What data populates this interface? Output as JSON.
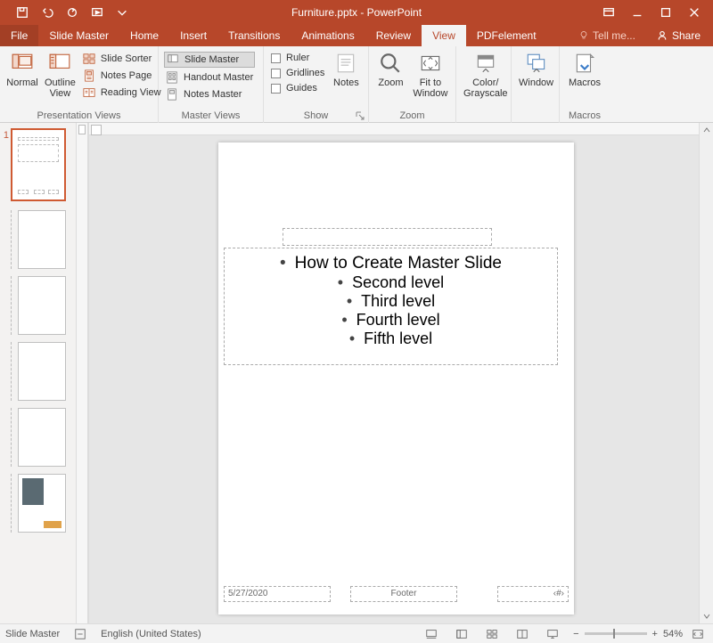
{
  "app": {
    "title": "Furniture.pptx - PowerPoint"
  },
  "tabs": {
    "file": "File",
    "items": [
      "Slide Master",
      "Home",
      "Insert",
      "Transitions",
      "Animations",
      "Review",
      "View",
      "PDFelement"
    ],
    "active": "View",
    "tell": "Tell me...",
    "share": "Share"
  },
  "ribbon": {
    "presentation_views": {
      "label": "Presentation Views",
      "normal": "Normal",
      "outline": "Outline View",
      "slide_sorter": "Slide Sorter",
      "notes_page": "Notes Page",
      "reading_view": "Reading View"
    },
    "master_views": {
      "label": "Master Views",
      "slide_master": "Slide Master",
      "handout_master": "Handout Master",
      "notes_master": "Notes Master"
    },
    "show": {
      "label": "Show",
      "ruler": "Ruler",
      "gridlines": "Gridlines",
      "guides": "Guides",
      "notes": "Notes"
    },
    "zoom_group": {
      "label": "Zoom",
      "zoom": "Zoom",
      "fit": "Fit to Window"
    },
    "color": {
      "label": "Color/ Grayscale"
    },
    "window": {
      "label": "Window"
    },
    "macros": {
      "label": "Macros",
      "button": "Macros"
    }
  },
  "slide": {
    "body": {
      "l1": "How to Create Master Slide",
      "l2": "Second level",
      "l3": "Third level",
      "l4": "Fourth level",
      "l5": "Fifth level"
    },
    "date": "5/27/2020",
    "footer": "Footer",
    "number": "‹#›"
  },
  "thumbs": {
    "master_index": "1"
  },
  "status": {
    "view": "Slide Master",
    "language": "English (United States)",
    "zoom": "54%"
  }
}
